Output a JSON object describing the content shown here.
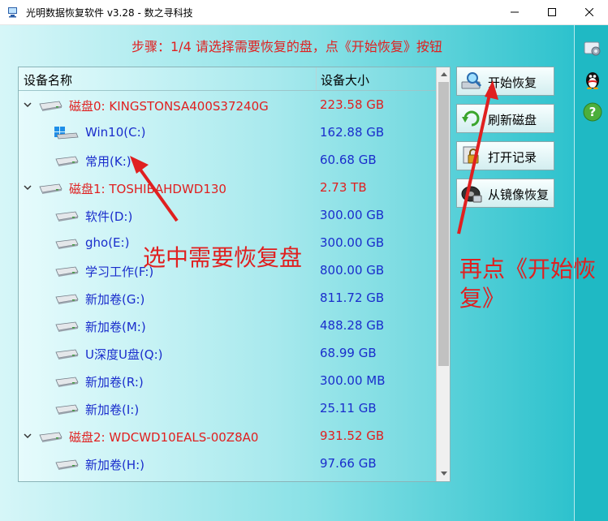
{
  "window": {
    "title": "光明数据恢复软件 v3.28 - 数之寻科技",
    "controls": [
      "minimize",
      "maximize",
      "close"
    ]
  },
  "step_text": "步骤：1/4 请选择需要恢复的盘，点《开始恢复》按钮",
  "table": {
    "col_name": "设备名称",
    "col_size": "设备大小"
  },
  "rows": [
    {
      "name": "磁盘0: KINGSTONSA400S37240G",
      "size": "223.58 GB",
      "level": 0,
      "type": "disk",
      "color": "#e02020"
    },
    {
      "name": "Win10(C:)",
      "size": "162.88 GB",
      "level": 1,
      "type": "win",
      "color": "#1a2dcc"
    },
    {
      "name": "常用(K:)",
      "size": "60.68 GB",
      "level": 1,
      "type": "drive",
      "color": "#1a2dcc"
    },
    {
      "name": "磁盘1: TOSHIBAHDWD130",
      "size": "2.73 TB",
      "level": 0,
      "type": "disk",
      "color": "#e02020"
    },
    {
      "name": " 软件(D:)",
      "size": "300.00 GB",
      "level": 1,
      "type": "drive",
      "color": "#1a2dcc"
    },
    {
      "name": "gho(E:)",
      "size": "300.00 GB",
      "level": 1,
      "type": "drive",
      "color": "#1a2dcc"
    },
    {
      "name": "学习工作(F:)",
      "size": "800.00 GB",
      "level": 1,
      "type": "drive",
      "color": "#1a2dcc"
    },
    {
      "name": "新加卷(G:)",
      "size": "811.72 GB",
      "level": 1,
      "type": "drive",
      "color": "#1a2dcc"
    },
    {
      "name": "新加卷(M:)",
      "size": "488.28 GB",
      "level": 1,
      "type": "drive",
      "color": "#1a2dcc"
    },
    {
      "name": "U深度U盘(Q:)",
      "size": "68.99 GB",
      "level": 1,
      "type": "drive",
      "color": "#1a2dcc"
    },
    {
      "name": "新加卷(R:)",
      "size": "300.00 MB",
      "level": 1,
      "type": "drive",
      "color": "#1a2dcc"
    },
    {
      "name": "新加卷(I:)",
      "size": "25.11 GB",
      "level": 1,
      "type": "drive",
      "color": "#1a2dcc"
    },
    {
      "name": "磁盘2: WDCWD10EALS-00Z8A0",
      "size": "931.52 GB",
      "level": 0,
      "type": "disk",
      "color": "#e02020"
    },
    {
      "name": "新加卷(H:)",
      "size": "97.66 GB",
      "level": 1,
      "type": "drive",
      "color": "#1a2dcc"
    }
  ],
  "buttons": [
    {
      "label": "开始恢复",
      "icon": "magnifier-drive-icon"
    },
    {
      "label": "刷新磁盘",
      "icon": "refresh-icon"
    },
    {
      "label": "打开记录",
      "icon": "lock-file-icon"
    },
    {
      "label": "从镜像恢复",
      "icon": "disk-image-icon"
    }
  ],
  "right_icons": [
    "settings-gear-icon",
    "qq-penguin-icon",
    "help-icon"
  ],
  "annotations": {
    "left": "选中需要恢复盘",
    "right_line1": "再点《开始恢",
    "right_line2": "复》"
  },
  "colors": {
    "accent_red": "#e02020",
    "partition_blue": "#1a2dcc"
  }
}
